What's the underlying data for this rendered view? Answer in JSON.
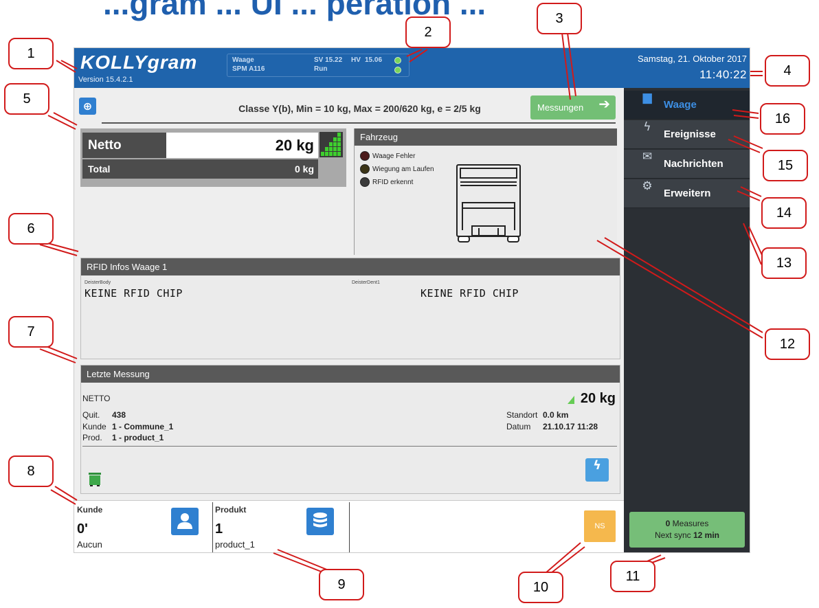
{
  "doc_heading": "...gram ... UI ... peration ...",
  "header": {
    "logo": "KOLLYgram",
    "version": "Version 15.4.2.1",
    "status": {
      "scale_label": "Waage",
      "model": "SPM A116",
      "sv": "SV 15.22",
      "hv_label": "HV",
      "hv": "15.06",
      "state": "Run"
    },
    "date": "Samstag, 21. Oktober 2017",
    "time": "11:40:22"
  },
  "class_line": "Classe Y(b), Min = 10 kg, Max = 200/620 kg, e = 2/5 kg",
  "measure_button": "Messungen",
  "weight": {
    "netto_label": "Netto",
    "netto_value": "20 kg",
    "total_label": "Total",
    "total_value": "0 kg"
  },
  "vehicle": {
    "title": "Fahrzeug",
    "indicators": [
      {
        "label": "Waage Fehler",
        "color": "#4a1a1a"
      },
      {
        "label": "Wiegung am Laufen",
        "color": "#3b3416"
      },
      {
        "label": "RFID erkennt",
        "color": "#3a3a3a"
      }
    ]
  },
  "rfid": {
    "title": "RFID Infos Waage 1",
    "left_tag": "DeisterBody",
    "left_value": "KEINE RFID CHIP",
    "right_tag": "DeisterDent1",
    "right_value": "KEINE RFID CHIP"
  },
  "last_measure": {
    "title": "Letzte Messung",
    "type": "NETTO",
    "value": "20 kg",
    "quit_label": "Quit.",
    "quit": "438",
    "kunde_label": "Kunde",
    "kunde": "1 - Commune_1",
    "prod_label": "Prod.",
    "prod": "1 - product_1",
    "standort_label": "Standort",
    "standort": "0.0 km",
    "datum_label": "Datum",
    "datum": "21.10.17 11:28"
  },
  "bottom": {
    "kunde_title": "Kunde",
    "kunde_value": "0'",
    "kunde_sub": "Aucun",
    "produkt_title": "Produkt",
    "produkt_value": "1",
    "produkt_sub": "product_1",
    "ns_label": "NS"
  },
  "sidebar": {
    "items": [
      {
        "label": "Waage",
        "icon": "bus-icon"
      },
      {
        "label": "Ereignisse",
        "icon": "bolt-icon"
      },
      {
        "label": "Nachrichten",
        "icon": "envelope-icon"
      },
      {
        "label": "Erweitern",
        "icon": "gears-icon"
      }
    ],
    "sync": {
      "count": "0",
      "count_label": "Measures",
      "next_label": "Next sync",
      "next_value": "12 min"
    }
  },
  "callouts": [
    "1",
    "2",
    "3",
    "4",
    "5",
    "6",
    "7",
    "8",
    "9",
    "10",
    "11",
    "12",
    "13",
    "14",
    "15",
    "16"
  ],
  "colors": {
    "header": "#1f64ac",
    "accent_green": "#73bf75",
    "callout_red": "#d11a1a",
    "sidebar": "#2b2f34",
    "ns_orange": "#f5b84d"
  }
}
